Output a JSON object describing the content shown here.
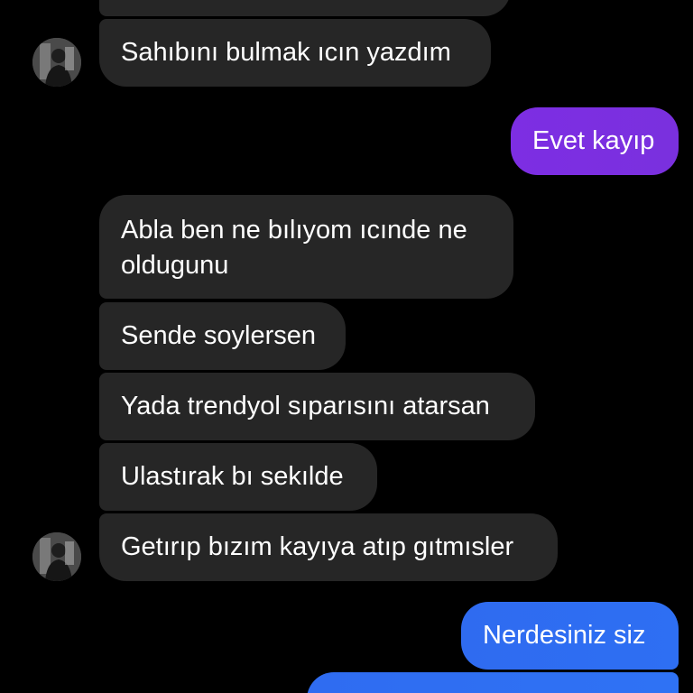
{
  "colors": {
    "background": "#000000",
    "incoming_bubble": "#262626",
    "outgoing_purple": "#7b2fe0",
    "outgoing_blue": "#2f6ef2",
    "text": "#ffffff"
  },
  "avatar_icon": "user-photo-avatar",
  "messages": [
    {
      "direction": "incoming",
      "text": ""
    },
    {
      "direction": "incoming",
      "text": "Sahıbını bulmak ıcın yazdım"
    },
    {
      "direction": "outgoing",
      "text": "Evet kayıp"
    },
    {
      "direction": "incoming",
      "text": "Abla ben ne bılıyom ıcınde ne oldugunu"
    },
    {
      "direction": "incoming",
      "text": "Sende soylersen"
    },
    {
      "direction": "incoming",
      "text": "Yada trendyol sıparısını atarsan"
    },
    {
      "direction": "incoming",
      "text": "Ulastırak bı sekılde"
    },
    {
      "direction": "incoming",
      "text": "Getırıp bızım kayıya atıp gıtmısler"
    },
    {
      "direction": "outgoing",
      "text": "Nerdesiniz siz"
    },
    {
      "direction": "outgoing",
      "text": ""
    }
  ]
}
